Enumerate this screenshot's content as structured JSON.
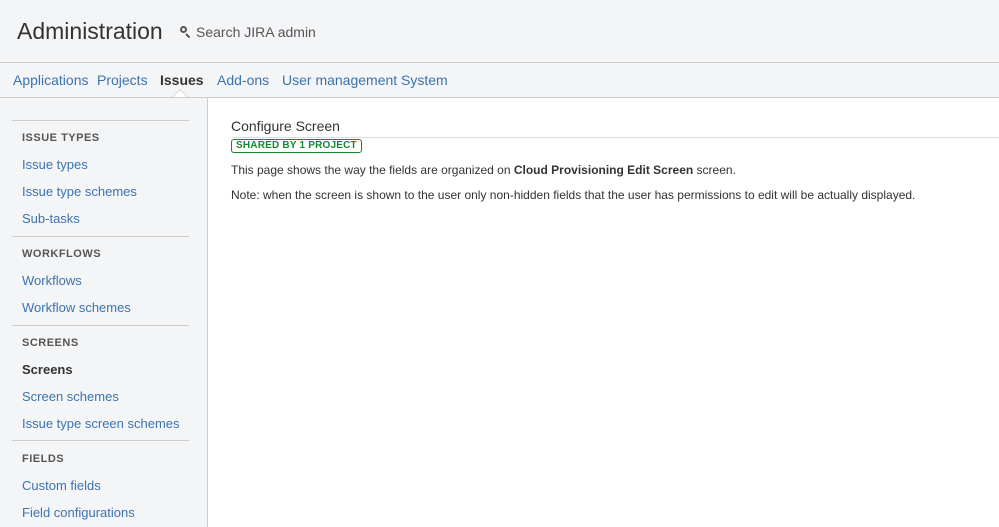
{
  "header": {
    "title": "Administration",
    "search_placeholder": "Search JIRA admin"
  },
  "nav": {
    "items": [
      {
        "label": "Applications"
      },
      {
        "label": "Projects"
      },
      {
        "label": "Issues",
        "active": true
      },
      {
        "label": "Add-ons"
      },
      {
        "label": "User management"
      },
      {
        "label": "System"
      }
    ]
  },
  "sidebar": {
    "sections": [
      {
        "heading": "ISSUE TYPES",
        "links": [
          "Issue types",
          "Issue type schemes",
          "Sub-tasks"
        ]
      },
      {
        "heading": "WORKFLOWS",
        "links": [
          "Workflows",
          "Workflow schemes"
        ]
      },
      {
        "heading": "SCREENS",
        "links": [
          "Screens",
          "Screen schemes",
          "Issue type screen schemes"
        ],
        "current": "Screens"
      },
      {
        "heading": "FIELDS",
        "links": [
          "Custom fields",
          "Field configurations"
        ]
      }
    ]
  },
  "main": {
    "title": "Configure Screen",
    "lozenge": "SHARED BY 1 PROJECT",
    "desc_prefix": "This page shows the way the fields are organized on",
    "screen_name": "Cloud Provisioning Edit Screen",
    "desc_suffix": "screen.",
    "note": "Note: when the screen is shown to the user only non-hidden fields that the user has permissions to edit will be actually displayed."
  },
  "colors": {
    "link": "#3b73af",
    "lozenge": "#14892c",
    "header_bg": "#f4f5f7"
  }
}
